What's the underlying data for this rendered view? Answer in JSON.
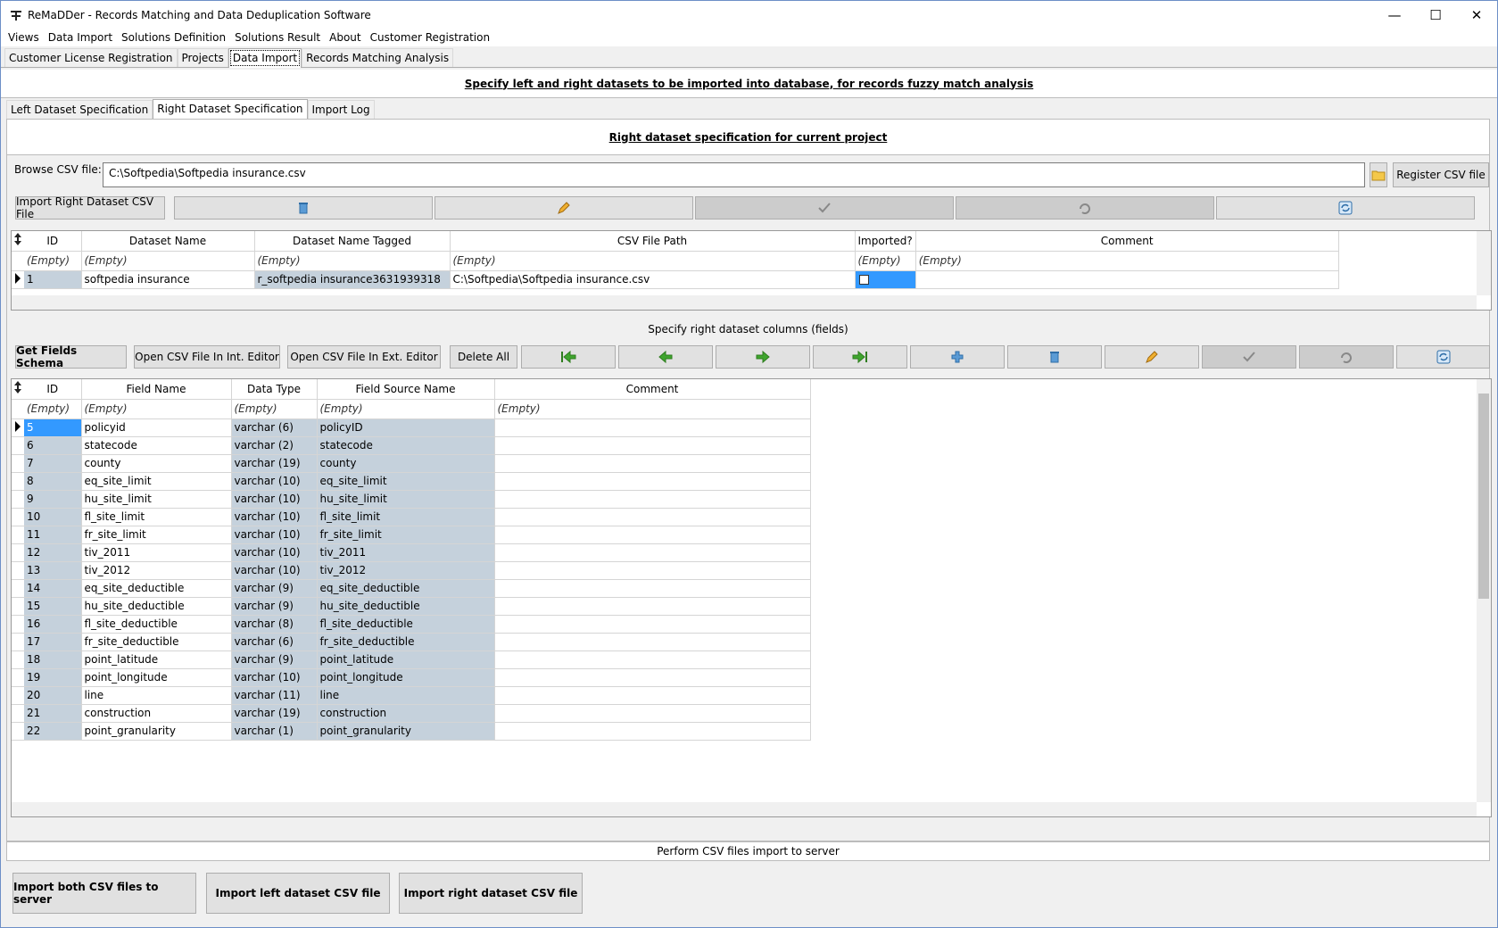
{
  "window": {
    "title": "ReMaDDer - Records Matching and Data Deduplication Software"
  },
  "menu": [
    "Views",
    "Data Import",
    "Solutions Definition",
    "Solutions Result",
    "About",
    "Customer Registration"
  ],
  "main_tabs": [
    "Customer License Registration",
    "Projects",
    "Data Import",
    "Records Matching Analysis"
  ],
  "import_header": "Specify left and right datasets to be imported into database, for records fuzzy match analysis",
  "sub_tabs": [
    "Left Dataset Specification",
    "Right Dataset Specification",
    "Import Log"
  ],
  "right_header": "Right dataset specification for current project",
  "browse": {
    "label": "Browse CSV file:",
    "value": "C:\\Softpedia\\Softpedia insurance.csv",
    "register_label": "Register CSV file"
  },
  "import_right_btn": "Import Right Dataset CSV File",
  "dataset_grid": {
    "columns": [
      "ID",
      "Dataset Name",
      "Dataset Name Tagged",
      "CSV File Path",
      "Imported?",
      "Comment"
    ],
    "filter": "(Empty)",
    "rows": [
      {
        "id": "1",
        "name": "softpedia insurance",
        "tagged": "r_softpedia insurance3631939318",
        "path": "C:\\Softpedia\\Softpedia insurance.csv"
      }
    ]
  },
  "fields_header": "Specify right dataset columns (fields)",
  "fields_buttons": {
    "get_schema": "Get Fields Schema",
    "open_int": "Open CSV File In Int. Editor",
    "open_ext": "Open CSV File In Ext. Editor",
    "delete_all": "Delete All"
  },
  "fields_grid": {
    "columns": [
      "ID",
      "Field Name",
      "Data Type",
      "Field Source Name",
      "Comment"
    ],
    "filter": "(Empty)",
    "rows": [
      [
        "5",
        "policyid",
        "varchar (6)",
        "policyID"
      ],
      [
        "6",
        "statecode",
        "varchar (2)",
        "statecode"
      ],
      [
        "7",
        "county",
        "varchar (19)",
        "county"
      ],
      [
        "8",
        "eq_site_limit",
        "varchar (10)",
        "eq_site_limit"
      ],
      [
        "9",
        "hu_site_limit",
        "varchar (10)",
        "hu_site_limit"
      ],
      [
        "10",
        "fl_site_limit",
        "varchar (10)",
        "fl_site_limit"
      ],
      [
        "11",
        "fr_site_limit",
        "varchar (10)",
        "fr_site_limit"
      ],
      [
        "12",
        "tiv_2011",
        "varchar (10)",
        "tiv_2011"
      ],
      [
        "13",
        "tiv_2012",
        "varchar (10)",
        "tiv_2012"
      ],
      [
        "14",
        "eq_site_deductible",
        "varchar (9)",
        "eq_site_deductible"
      ],
      [
        "15",
        "hu_site_deductible",
        "varchar (9)",
        "hu_site_deductible"
      ],
      [
        "16",
        "fl_site_deductible",
        "varchar (8)",
        "fl_site_deductible"
      ],
      [
        "17",
        "fr_site_deductible",
        "varchar (6)",
        "fr_site_deductible"
      ],
      [
        "18",
        "point_latitude",
        "varchar (9)",
        "point_latitude"
      ],
      [
        "19",
        "point_longitude",
        "varchar (10)",
        "point_longitude"
      ],
      [
        "20",
        "line",
        "varchar (11)",
        "line"
      ],
      [
        "21",
        "construction",
        "varchar (19)",
        "construction"
      ],
      [
        "22",
        "point_granularity",
        "varchar (1)",
        "point_granularity"
      ]
    ]
  },
  "perform_header": "Perform CSV files import to server",
  "import_buttons": [
    "Import both CSV files to server",
    "Import left dataset CSV file",
    "Import right dataset CSV file"
  ],
  "colors": {
    "selection": "#3399ff",
    "readonly_cell": "#c5d1dc",
    "nav_green": "#3fa52e"
  }
}
